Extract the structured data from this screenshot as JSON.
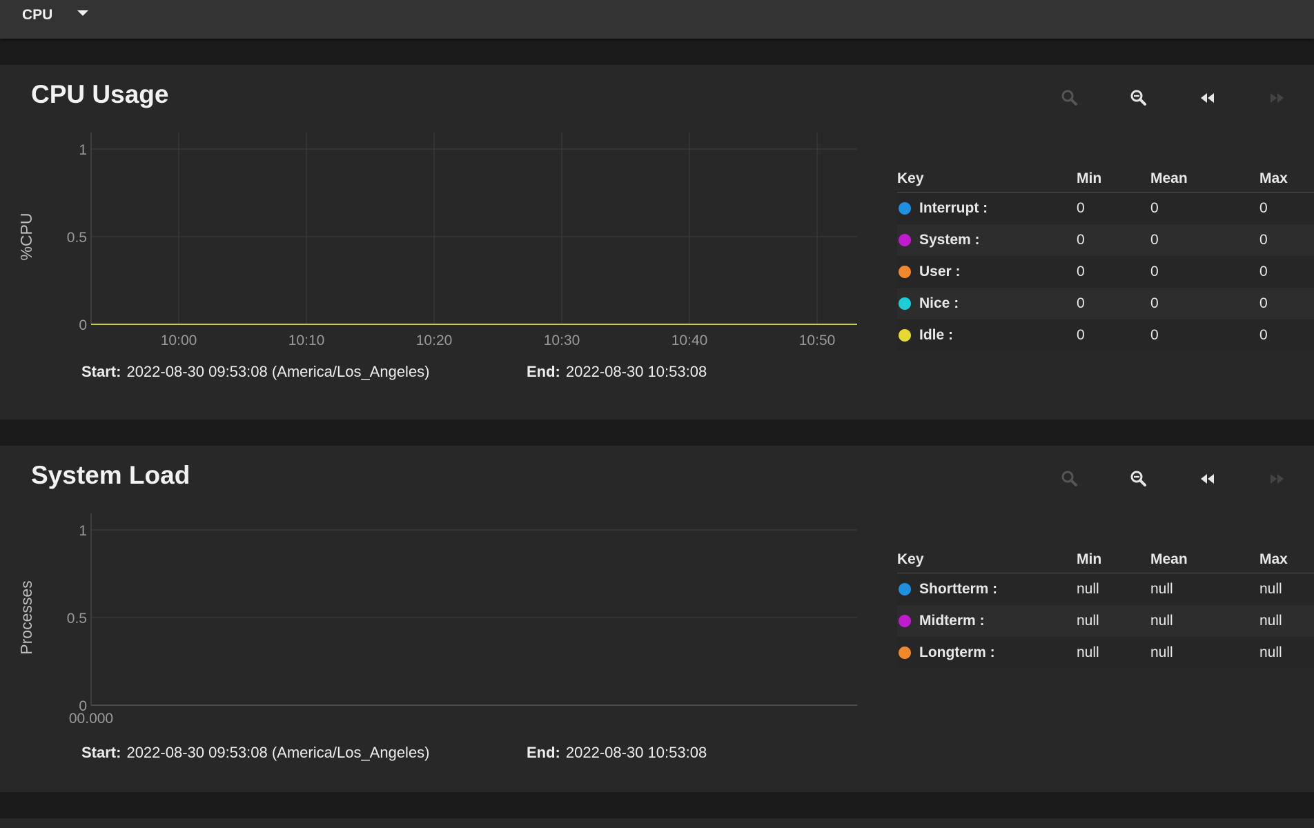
{
  "topbar": {
    "selector_label": "CPU",
    "selector_icon": "caret-down-icon"
  },
  "cards": {
    "cpu": {
      "title": "CPU Usage",
      "toolbar": [
        "zoom-in-icon",
        "zoom-out-icon",
        "rewind-icon",
        "fast-forward-icon"
      ],
      "range": {
        "start_label": "Start:",
        "start_value": "2022-08-30 09:53:08 (America/Los_Angeles)",
        "end_label": "End:",
        "end_value": "2022-08-30 10:53:08"
      },
      "legend": {
        "headers": {
          "key": "Key",
          "min": "Min",
          "mean": "Mean",
          "max": "Max"
        },
        "rows": [
          {
            "name": "Interrupt :",
            "color": "#1e90e0",
            "min": "0",
            "mean": "0",
            "max": "0"
          },
          {
            "name": "System :",
            "color": "#c21bcf",
            "min": "0",
            "mean": "0",
            "max": "0"
          },
          {
            "name": "User :",
            "color": "#f0882c",
            "min": "0",
            "mean": "0",
            "max": "0"
          },
          {
            "name": "Nice :",
            "color": "#1ccfd6",
            "min": "0",
            "mean": "0",
            "max": "0"
          },
          {
            "name": "Idle :",
            "color": "#e6d930",
            "min": "0",
            "mean": "0",
            "max": "0"
          }
        ]
      }
    },
    "load": {
      "title": "System Load",
      "toolbar": [
        "zoom-in-icon",
        "zoom-out-icon",
        "rewind-icon",
        "fast-forward-icon"
      ],
      "range": {
        "start_label": "Start:",
        "start_value": "2022-08-30 09:53:08 (America/Los_Angeles)",
        "end_label": "End:",
        "end_value": "2022-08-30 10:53:08"
      },
      "legend": {
        "headers": {
          "key": "Key",
          "min": "Min",
          "mean": "Mean",
          "max": "Max"
        },
        "rows": [
          {
            "name": "Shortterm :",
            "color": "#1e90e0",
            "min": "null",
            "mean": "null",
            "max": "null"
          },
          {
            "name": "Midterm :",
            "color": "#c21bcf",
            "min": "null",
            "mean": "null",
            "max": "null"
          },
          {
            "name": "Longterm :",
            "color": "#f0882c",
            "min": "null",
            "mean": "null",
            "max": "null"
          }
        ]
      }
    }
  },
  "chart_data": [
    {
      "type": "line",
      "ylabel": "%CPU",
      "xlabel": "",
      "x_ticks": [
        "10:00",
        "10:10",
        "10:20",
        "10:30",
        "10:40",
        "10:50"
      ],
      "y_ticks": [
        "0",
        "0.5",
        "1"
      ],
      "ylim": [
        0,
        1
      ],
      "x_range": [
        "09:53:08",
        "10:53:08"
      ],
      "grid": true,
      "series": [
        {
          "name": "Interrupt",
          "color": "#1e90e0",
          "x": [
            "09:53:08",
            "10:53:08"
          ],
          "y": [
            0,
            0
          ]
        },
        {
          "name": "System",
          "color": "#c21bcf",
          "x": [
            "09:53:08",
            "10:53:08"
          ],
          "y": [
            0,
            0
          ]
        },
        {
          "name": "User",
          "color": "#f0882c",
          "x": [
            "09:53:08",
            "10:53:08"
          ],
          "y": [
            0,
            0
          ]
        },
        {
          "name": "Nice",
          "color": "#1ccfd6",
          "x": [
            "09:53:08",
            "10:53:08"
          ],
          "y": [
            0,
            0
          ]
        },
        {
          "name": "Idle",
          "color": "#e6d930",
          "x": [
            "09:53:08",
            "10:53:08"
          ],
          "y": [
            0,
            0
          ]
        }
      ]
    },
    {
      "type": "line",
      "ylabel": "Processes",
      "xlabel": "",
      "x_ticks": [
        "00.000"
      ],
      "y_ticks": [
        "0",
        "0.5",
        "1"
      ],
      "ylim": [
        0,
        1
      ],
      "grid": true,
      "series": [
        {
          "name": "Shortterm",
          "color": "#1e90e0",
          "x": [],
          "y": []
        },
        {
          "name": "Midterm",
          "color": "#c21bcf",
          "x": [],
          "y": []
        },
        {
          "name": "Longterm",
          "color": "#f0882c",
          "x": [],
          "y": []
        }
      ]
    }
  ]
}
